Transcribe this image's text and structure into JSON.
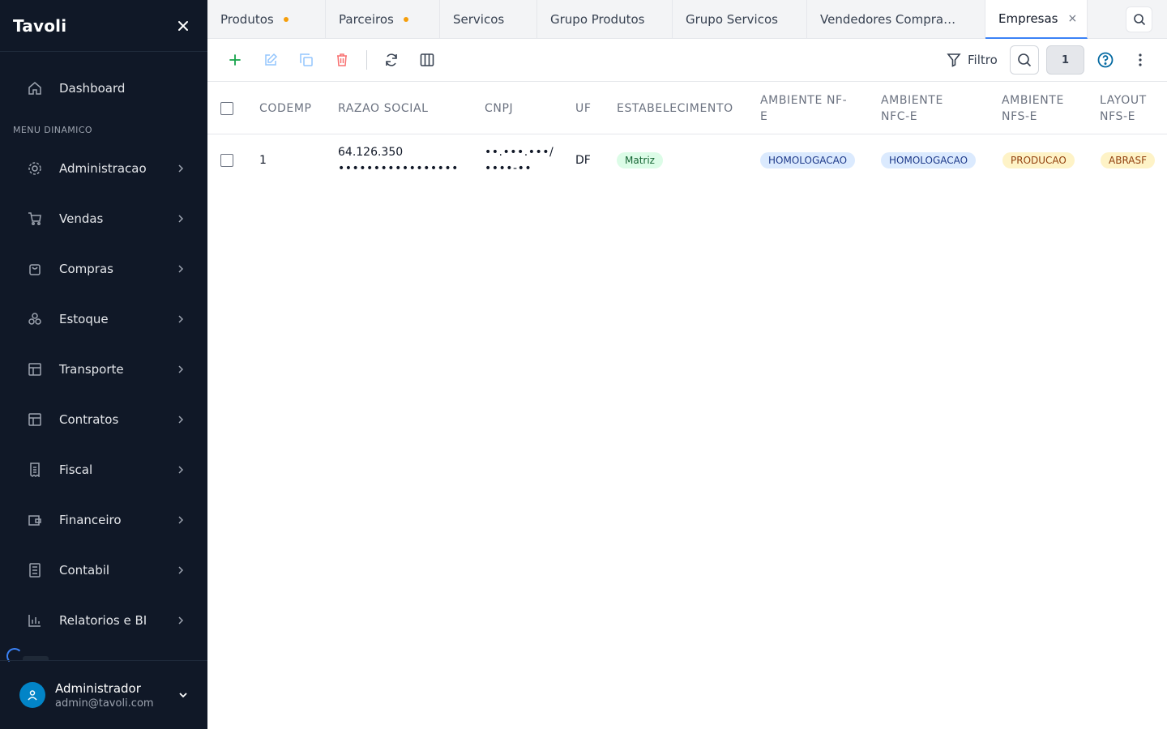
{
  "sidebar": {
    "brand": "Tavoli",
    "dashboard": "Dashboard",
    "section_label": "MENU DINAMICO",
    "items": [
      {
        "label": "Administracao",
        "icon": "gear-icon"
      },
      {
        "label": "Vendas",
        "icon": "cart-icon"
      },
      {
        "label": "Compras",
        "icon": "bag-icon"
      },
      {
        "label": "Estoque",
        "icon": "boxes-icon"
      },
      {
        "label": "Transporte",
        "icon": "layout-icon"
      },
      {
        "label": "Contratos",
        "icon": "layout-icon"
      },
      {
        "label": "Fiscal",
        "icon": "receipt-icon"
      },
      {
        "label": "Financeiro",
        "icon": "wallet-icon"
      },
      {
        "label": "Contabil",
        "icon": "ledger-icon"
      },
      {
        "label": "Relatorios e BI",
        "icon": "chart-icon"
      }
    ],
    "user": {
      "name": "Administrador",
      "email": "admin@tavoli.com"
    }
  },
  "tabs": [
    {
      "label": "Produtos",
      "modified": true
    },
    {
      "label": "Parceiros",
      "modified": true
    },
    {
      "label": "Servicos"
    },
    {
      "label": "Grupo Produtos"
    },
    {
      "label": "Grupo Servicos"
    },
    {
      "label": "Vendedores Compra…"
    },
    {
      "label": "Empresas",
      "active": true,
      "close": "×"
    }
  ],
  "toolbar": {
    "filter_label": "Filtro",
    "record_count": "1"
  },
  "table": {
    "columns": [
      {
        "line1": "CODEMP",
        "line2": ""
      },
      {
        "line1": "RAZAO SOCIAL",
        "line2": ""
      },
      {
        "line1": "CNPJ",
        "line2": ""
      },
      {
        "line1": "UF",
        "line2": ""
      },
      {
        "line1": "ESTABELECIMENTO",
        "line2": ""
      },
      {
        "line1": "AMBIENTE NF-",
        "line2": "E"
      },
      {
        "line1": "AMBIENTE",
        "line2": "NFC-E"
      },
      {
        "line1": "AMBIENTE",
        "line2": "NFS-E"
      },
      {
        "line1": "LAYOUT",
        "line2": "NFS-E"
      }
    ],
    "rows": [
      {
        "codemp": "1",
        "razao_line1": "64.126.350",
        "razao_line2": "•••••••••••••••••",
        "cnpj_line1": "••.•••.•••/",
        "cnpj_line2": "••••-••",
        "uf": "DF",
        "estabelecimento": "Matriz",
        "ambiente_nfe": "HOMOLOGACAO",
        "ambiente_nfce": "HOMOLOGACAO",
        "ambiente_nfse": "PRODUCAO",
        "layout_nfse": "ABRASF"
      }
    ]
  },
  "colors": {
    "sidebar_bg": "#101827",
    "accent": "#3b82f6",
    "add": "#16a34a",
    "delete": "#ef4444",
    "modified_dot": "#f59e0b"
  }
}
